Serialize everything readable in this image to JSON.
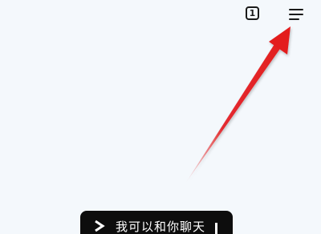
{
  "toolbar": {
    "tab_count": "1",
    "menu_icon": "hamburger-menu-icon"
  },
  "annotation": {
    "icon": "red-arrow-icon",
    "color": "#e31a1c"
  },
  "chat_bar": {
    "icon": "chevron-right-icon",
    "label": "我可以和你聊天"
  }
}
